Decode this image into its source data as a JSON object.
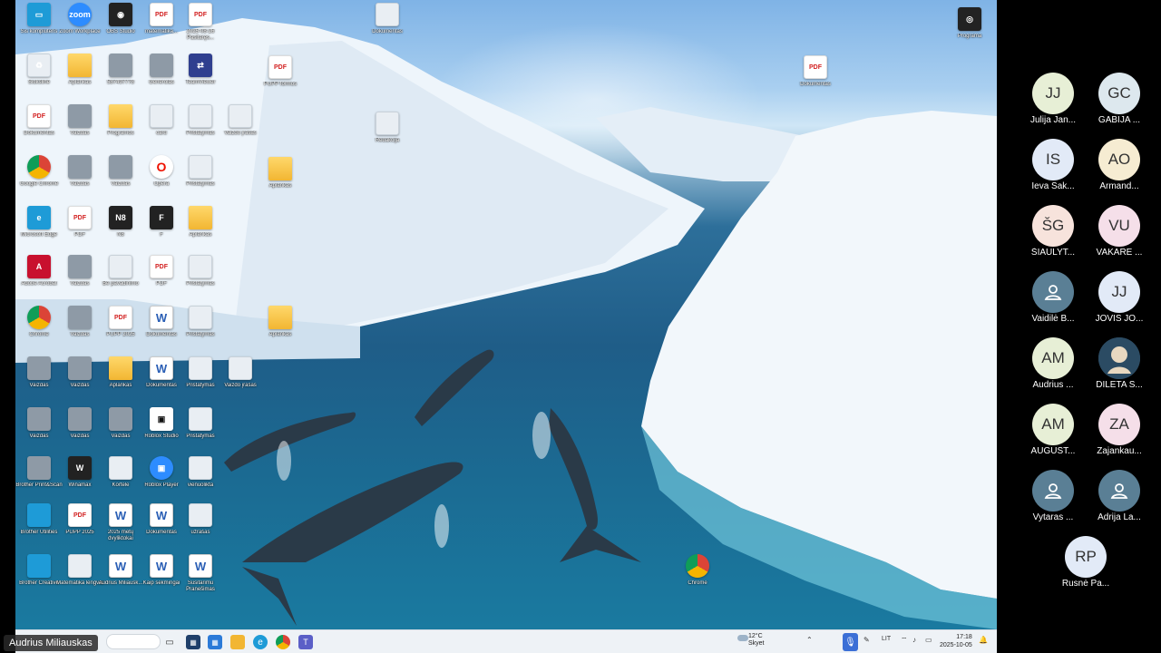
{
  "desktop": {
    "icons": [
      {
        "name": "this-pc",
        "label": "Šis kompiuteris",
        "kind": "teal",
        "glyph": "▭"
      },
      {
        "name": "zoom",
        "label": "Zoom Workplace",
        "kind": "blue",
        "glyph": "zoom"
      },
      {
        "name": "obs-studio",
        "label": "OBS Studio",
        "kind": "dark",
        "glyph": "◉"
      },
      {
        "name": "pdf-matematika",
        "label": "matematika...",
        "kind": "pdf",
        "glyph": "PDF"
      },
      {
        "name": "pdf-2025",
        "label": "2025-08-26 Pasitaręs...",
        "kind": "pdf",
        "glyph": "PDF"
      },
      {
        "name": "recycle-bin",
        "label": "Šiukšlinė",
        "kind": "light",
        "glyph": "♻"
      },
      {
        "name": "folder-1",
        "label": "Aplankas",
        "kind": "folder",
        "glyph": ""
      },
      {
        "name": "image-1",
        "label": "587497778",
        "kind": "gray",
        "glyph": ""
      },
      {
        "name": "generolas",
        "label": "Generolas",
        "kind": "gray",
        "glyph": ""
      },
      {
        "name": "teamviewer",
        "label": "TeamViewer",
        "kind": "navy",
        "glyph": "⇄"
      },
      {
        "name": "pdf-file",
        "label": "Dokumentas",
        "kind": "pdf",
        "glyph": "PDF"
      },
      {
        "name": "image-2",
        "label": "Vaizdas",
        "kind": "gray",
        "glyph": ""
      },
      {
        "name": "folder-2",
        "label": "Programos",
        "kind": "folder",
        "glyph": ""
      },
      {
        "name": "file-card",
        "label": "card",
        "kind": "light",
        "glyph": ""
      },
      {
        "name": "ppt-1",
        "label": "Pristatymas",
        "kind": "light",
        "glyph": ""
      },
      {
        "name": "video-1",
        "label": "Vaizdo įrašas",
        "kind": "light",
        "glyph": ""
      },
      {
        "name": "google-chrome",
        "label": "Google Chrome",
        "kind": "chrome",
        "glyph": ""
      },
      {
        "name": "image-3",
        "label": "Vaizdas",
        "kind": "gray",
        "glyph": ""
      },
      {
        "name": "image-4",
        "label": "Vaizdas",
        "kind": "gray",
        "glyph": ""
      },
      {
        "name": "opera",
        "label": "Opera",
        "kind": "opera",
        "glyph": "O"
      },
      {
        "name": "ppt-2",
        "label": "Pristatymas",
        "kind": "light",
        "glyph": ""
      },
      {
        "name": "microsoft-edge",
        "label": "Microsoft Edge",
        "kind": "teal",
        "glyph": "e"
      },
      {
        "name": "pdf-3",
        "label": "PDF",
        "kind": "pdf",
        "glyph": "PDF"
      },
      {
        "name": "n8",
        "label": "N8",
        "kind": "dark",
        "glyph": "N8"
      },
      {
        "name": "f-app",
        "label": "F",
        "kind": "dark",
        "glyph": "F"
      },
      {
        "name": "folder-3",
        "label": "Aplankas",
        "kind": "folder",
        "glyph": ""
      },
      {
        "name": "acrobat",
        "label": "Adobe Acrobat",
        "kind": "red",
        "glyph": "A"
      },
      {
        "name": "image-5",
        "label": "Vaizdas",
        "kind": "gray",
        "glyph": ""
      },
      {
        "name": "be-pavadinimo",
        "label": "Be pavadinimo",
        "kind": "light",
        "glyph": ""
      },
      {
        "name": "pdf-4",
        "label": "PDF",
        "kind": "pdf",
        "glyph": "PDF"
      },
      {
        "name": "ppt-3",
        "label": "Pristatymas",
        "kind": "light",
        "glyph": ""
      },
      {
        "name": "chrome-2",
        "label": "Chrome",
        "kind": "chrome",
        "glyph": ""
      },
      {
        "name": "image-6",
        "label": "Vaizdas",
        "kind": "gray",
        "glyph": ""
      },
      {
        "name": "pupp-pdf",
        "label": "PUPP 2025",
        "kind": "pdf",
        "glyph": "PDF"
      },
      {
        "name": "word-1",
        "label": "Dokumentas",
        "kind": "word",
        "glyph": "W"
      },
      {
        "name": "ppt-4",
        "label": "Pristatymas",
        "kind": "light",
        "glyph": ""
      },
      {
        "name": "image-7",
        "label": "Vaizdas",
        "kind": "gray",
        "glyph": ""
      },
      {
        "name": "image-8",
        "label": "Vaizdas",
        "kind": "gray",
        "glyph": ""
      },
      {
        "name": "folder-4",
        "label": "Aplankas",
        "kind": "folder",
        "glyph": ""
      },
      {
        "name": "word-2",
        "label": "Dokumentas",
        "kind": "word",
        "glyph": "W"
      },
      {
        "name": "ppt-5",
        "label": "Pristatymas",
        "kind": "light",
        "glyph": ""
      },
      {
        "name": "video-2",
        "label": "Vaizdo įrašas",
        "kind": "light",
        "glyph": ""
      },
      {
        "name": "image-9",
        "label": "Vaizdas",
        "kind": "gray",
        "glyph": ""
      },
      {
        "name": "image-10",
        "label": "Vaizdas",
        "kind": "gray",
        "glyph": ""
      },
      {
        "name": "image-11",
        "label": "Vaizdas",
        "kind": "gray",
        "glyph": ""
      },
      {
        "name": "roblox-studio",
        "label": "Roblox Studio",
        "kind": "roblox",
        "glyph": "▣"
      },
      {
        "name": "ppt-6",
        "label": "Pristatymas",
        "kind": "light",
        "glyph": ""
      },
      {
        "name": "brother-print",
        "label": "Brother Print&Scan",
        "kind": "gray",
        "glyph": ""
      },
      {
        "name": "winamax",
        "label": "Winamax",
        "kind": "dark",
        "glyph": "W"
      },
      {
        "name": "kortele",
        "label": "Kortelė",
        "kind": "light",
        "glyph": ""
      },
      {
        "name": "roblox-player",
        "label": "Roblox Player",
        "kind": "blue",
        "glyph": "▣"
      },
      {
        "name": "vienuolikta",
        "label": "vienuolikta",
        "kind": "light",
        "glyph": ""
      },
      {
        "name": "brother-utilities",
        "label": "Brother Utilities",
        "kind": "teal",
        "glyph": ""
      },
      {
        "name": "pupp-2025",
        "label": "PUPP 2025",
        "kind": "pdf",
        "glyph": "PDF"
      },
      {
        "name": "word-3",
        "label": "2025 metų dvyliktokai",
        "kind": "word",
        "glyph": "W"
      },
      {
        "name": "word-4",
        "label": "Dokumentas",
        "kind": "word",
        "glyph": "W"
      },
      {
        "name": "uzrasas",
        "label": "užrašas",
        "kind": "light",
        "glyph": ""
      },
      {
        "name": "brother-creative",
        "label": "Brother Creative",
        "kind": "teal",
        "glyph": ""
      },
      {
        "name": "matematika-lengvai",
        "label": "Matematika lengvai",
        "kind": "light",
        "glyph": ""
      },
      {
        "name": "word-5",
        "label": "Audrius Miliausk...",
        "kind": "word",
        "glyph": "W"
      },
      {
        "name": "word-6",
        "label": "Kaip sekmingai",
        "kind": "word",
        "glyph": "W"
      },
      {
        "name": "word-7",
        "label": "Susitarimu Pranešimas",
        "kind": "word",
        "glyph": "W"
      },
      {
        "name": "word-top",
        "label": "Dokumentas",
        "kind": "light",
        "glyph": ""
      },
      {
        "name": "pupp-forma",
        "label": "PUPP formos",
        "kind": "pdf",
        "glyph": "PDF"
      },
      {
        "name": "redakcija",
        "label": "Redakcija",
        "kind": "light",
        "glyph": ""
      },
      {
        "name": "folder-5",
        "label": "Aplankas",
        "kind": "folder",
        "glyph": ""
      },
      {
        "name": "folder-6",
        "label": "Aplankas",
        "kind": "folder",
        "glyph": ""
      },
      {
        "name": "pdf-right",
        "label": "Dokumentas",
        "kind": "pdf",
        "glyph": "PDF"
      },
      {
        "name": "chrome-shortcut",
        "label": "Chrome",
        "kind": "chrome",
        "glyph": ""
      },
      {
        "name": "top-right-app",
        "label": "Programa",
        "kind": "dark",
        "glyph": "◎"
      }
    ]
  },
  "taskbar": {
    "weather_temp": "12°C",
    "weather_text": "Skyet",
    "lang": "LIT",
    "time": "17:18",
    "date": "2025-10-05"
  },
  "speaker": "Audrius Miliauskas",
  "participants": [
    {
      "initials": "JJ",
      "name": "Julija Jan...",
      "color": "#e7efd6",
      "type": "initials"
    },
    {
      "initials": "GC",
      "name": "GABIJA ...",
      "color": "#dde8ee",
      "type": "initials"
    },
    {
      "initials": "IS",
      "name": "Ieva Sak...",
      "color": "#e2eaf7",
      "type": "initials"
    },
    {
      "initials": "AO",
      "name": "Armand...",
      "color": "#f6ecd2",
      "type": "initials"
    },
    {
      "initials": "ŠG",
      "name": "ŠIAULYT...",
      "color": "#f7e3dc",
      "type": "initials"
    },
    {
      "initials": "VU",
      "name": "VAKARĖ ...",
      "color": "#f5dfe9",
      "type": "initials"
    },
    {
      "initials": "",
      "name": "Vaidilė B...",
      "color": "#5a7f95",
      "type": "person"
    },
    {
      "initials": "JJ",
      "name": "JOVIS JO...",
      "color": "#e2eaf7",
      "type": "initials"
    },
    {
      "initials": "AM",
      "name": "Audrius ...",
      "color": "#e7efd6",
      "type": "initials"
    },
    {
      "initials": "",
      "name": "DILETA S...",
      "color": "#2b4b63",
      "type": "photo"
    },
    {
      "initials": "AM",
      "name": "AUGUST...",
      "color": "#e7efd6",
      "type": "initials"
    },
    {
      "initials": "ZA",
      "name": "Zajankau...",
      "color": "#f5dfe9",
      "type": "initials"
    },
    {
      "initials": "",
      "name": "Vytaras ...",
      "color": "#5a7f95",
      "type": "person"
    },
    {
      "initials": "",
      "name": "Adrija La...",
      "color": "#5a7f95",
      "type": "person"
    },
    {
      "initials": "RP",
      "name": "Rusnė Pa...",
      "color": "#e2eaf7",
      "type": "initials"
    }
  ]
}
